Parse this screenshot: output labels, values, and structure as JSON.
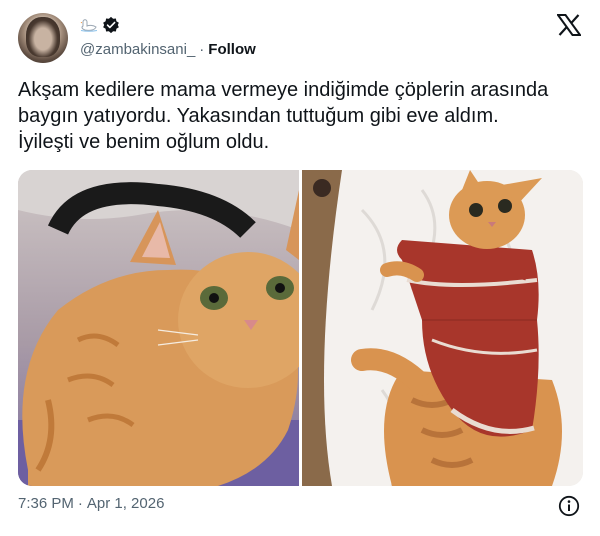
{
  "tweet": {
    "handle": "@zambakinsani_",
    "separator": "·",
    "follow_label": "Follow",
    "text_lines": [
      "Akşam kedilere mama vermeye indiğimde çöplerin arasında",
      "baygın yatıyordu. Yakasından tuttuğum gibi eve aldım.",
      "İyileşti ve benim oğlum oldu."
    ],
    "time": "7:36 PM",
    "date_separator": "·",
    "date": "Apr 1, 2026"
  },
  "icons": {
    "swan": "swan-emoji",
    "verified": "verified-badge-icon",
    "logo": "x-logo-icon",
    "info": "info-icon"
  },
  "colors": {
    "text": "#0f1419",
    "secondary": "#536471",
    "sweater": "#a8362b"
  }
}
